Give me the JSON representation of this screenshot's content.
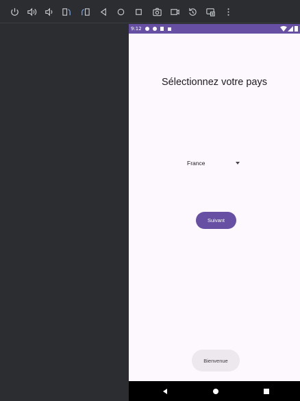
{
  "toolbar": {
    "icons": [
      "power-icon",
      "volume-up-icon",
      "volume-down-icon",
      "rotate-left-icon",
      "rotate-right-icon",
      "back-icon",
      "home-icon",
      "overview-icon",
      "screenshot-icon",
      "screen-record-icon",
      "replay-icon",
      "fold-icon",
      "more-icon"
    ]
  },
  "phone": {
    "status_bar": {
      "time": "9:12",
      "color": "#6750a4"
    },
    "title": "Sélectionnez votre pays",
    "country_select": {
      "value": "France"
    },
    "next_button": {
      "label": "Suivant",
      "color": "#6750a4"
    },
    "toast": {
      "text": "Bienvenue"
    },
    "nav_bar": {
      "buttons": [
        "back-icon",
        "home-icon",
        "recents-icon"
      ]
    }
  }
}
